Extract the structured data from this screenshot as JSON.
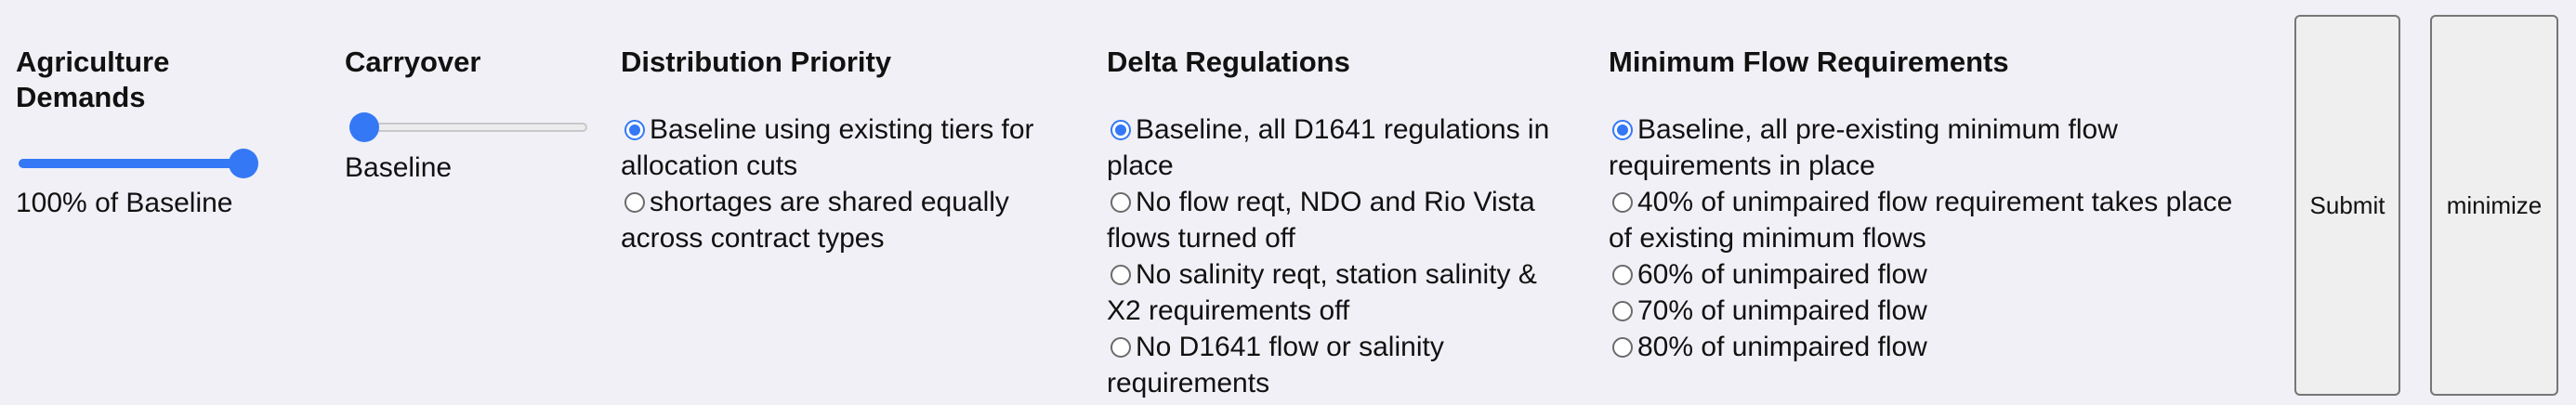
{
  "agriculture": {
    "heading": "Agriculture Demands",
    "slider_value_fraction": 1.0,
    "value_label": "100% of Baseline"
  },
  "carryover": {
    "heading": "Carryover",
    "slider_value_fraction": 0.0,
    "value_label": "Baseline"
  },
  "distribution": {
    "heading": "Distribution Priority",
    "options": [
      {
        "label": "Baseline using existing tiers for allocation cuts",
        "checked": true
      },
      {
        "label": "shortages are shared equally across contract types",
        "checked": false
      }
    ]
  },
  "delta": {
    "heading": "Delta Regulations",
    "options": [
      {
        "label": "Baseline, all D1641 regulations in place",
        "checked": true
      },
      {
        "label": "No flow reqt, NDO and Rio Vista flows turned off",
        "checked": false
      },
      {
        "label": "No salinity reqt, station salinity & X2 requirements off",
        "checked": false
      },
      {
        "label": "No D1641 flow or salinity requirements",
        "checked": false
      }
    ]
  },
  "minflow": {
    "heading": "Minimum Flow Requirements",
    "options": [
      {
        "label": "Baseline, all pre-existing minimum flow requirements in place",
        "checked": true
      },
      {
        "label": "40% of unimpaired flow requirement takes place of existing minimum flows",
        "checked": false
      },
      {
        "label": "60% of unimpaired flow",
        "checked": false
      },
      {
        "label": "70% of unimpaired flow",
        "checked": false
      },
      {
        "label": "80% of unimpaired flow",
        "checked": false
      }
    ]
  },
  "buttons": {
    "submit_label": "Submit",
    "minimize_label": "minimize"
  },
  "colors": {
    "accent": "#3478f6",
    "background": "#f0f0f6"
  }
}
